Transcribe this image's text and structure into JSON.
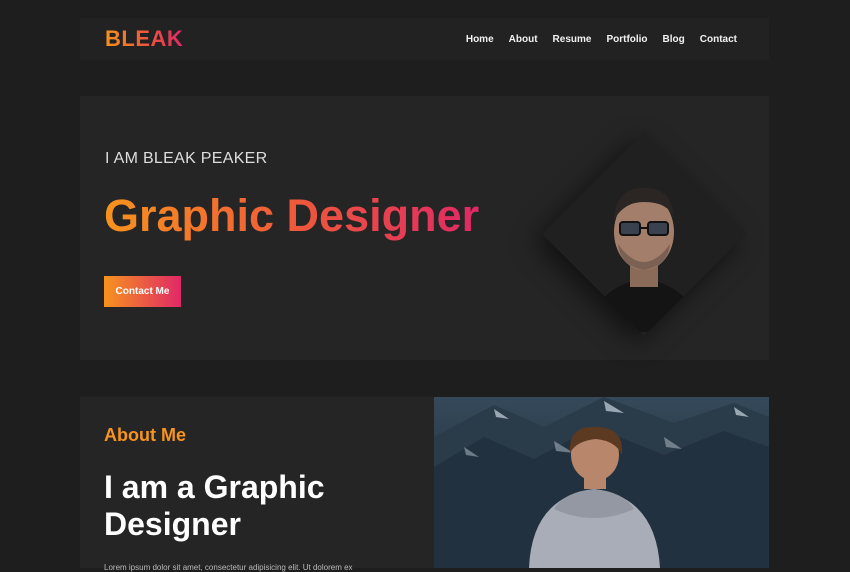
{
  "header": {
    "logo": "BLEAK",
    "nav": [
      "Home",
      "About",
      "Resume",
      "Portfolio",
      "Blog",
      "Contact"
    ]
  },
  "hero": {
    "intro": "I AM BLEAK PEAKER",
    "title": "Graphic Designer",
    "cta_label": "Contact Me"
  },
  "about": {
    "kicker": "About Me",
    "title": "I am a Graphic Designer",
    "text": "Lorem ipsum dolor sit amet, consectetur adipisicing elit. Ut dolorem ex"
  },
  "colors": {
    "background": "#1e1e1e",
    "panel": "#252525",
    "gradient_start": "#f7931e",
    "gradient_end": "#e02866"
  }
}
